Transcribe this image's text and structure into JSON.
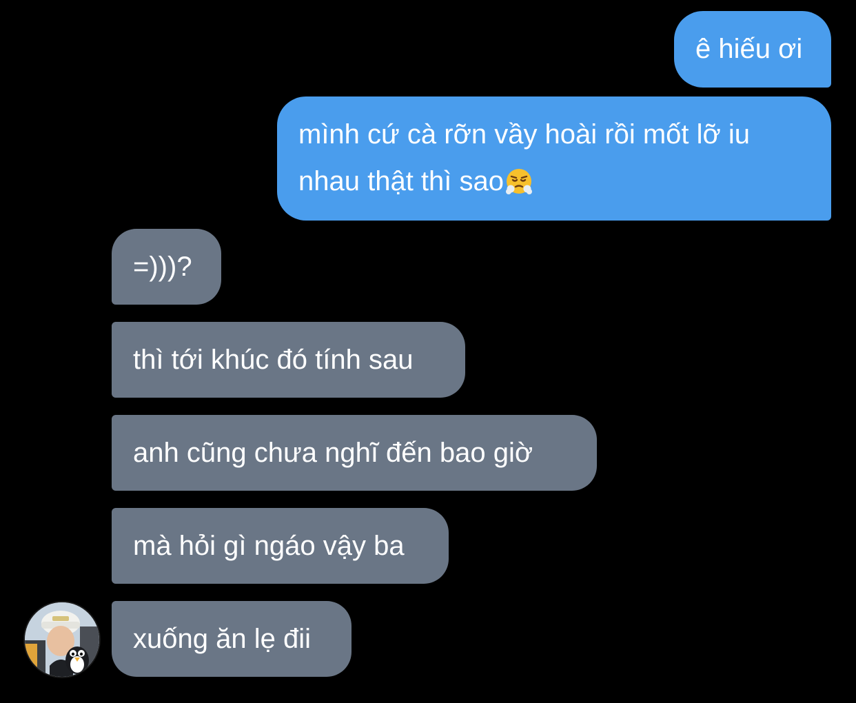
{
  "conversation": {
    "messages": [
      {
        "direction": "sent",
        "text": "ê hiếu ơi"
      },
      {
        "direction": "sent",
        "lines": [
          "mình cứ cà rỡn vầy hoài rồi mốt lỡ iu",
          "nhau thật thì sao"
        ],
        "emoji": "face-with-steam-from-nose-icon"
      },
      {
        "direction": "received",
        "text": "=)))?"
      },
      {
        "direction": "received",
        "text": "thì tới khúc đó tính sau"
      },
      {
        "direction": "received",
        "text": "anh cũng chưa nghĩ đến bao giờ"
      },
      {
        "direction": "received",
        "text": "mà hỏi gì ngáo vậy ba"
      },
      {
        "direction": "received",
        "text": "xuống ăn lẹ đii"
      }
    ]
  },
  "colors": {
    "background": "#000000",
    "sent_bubble": "#4a9ded",
    "received_bubble": "#6a7686",
    "text": "#ffffff"
  }
}
